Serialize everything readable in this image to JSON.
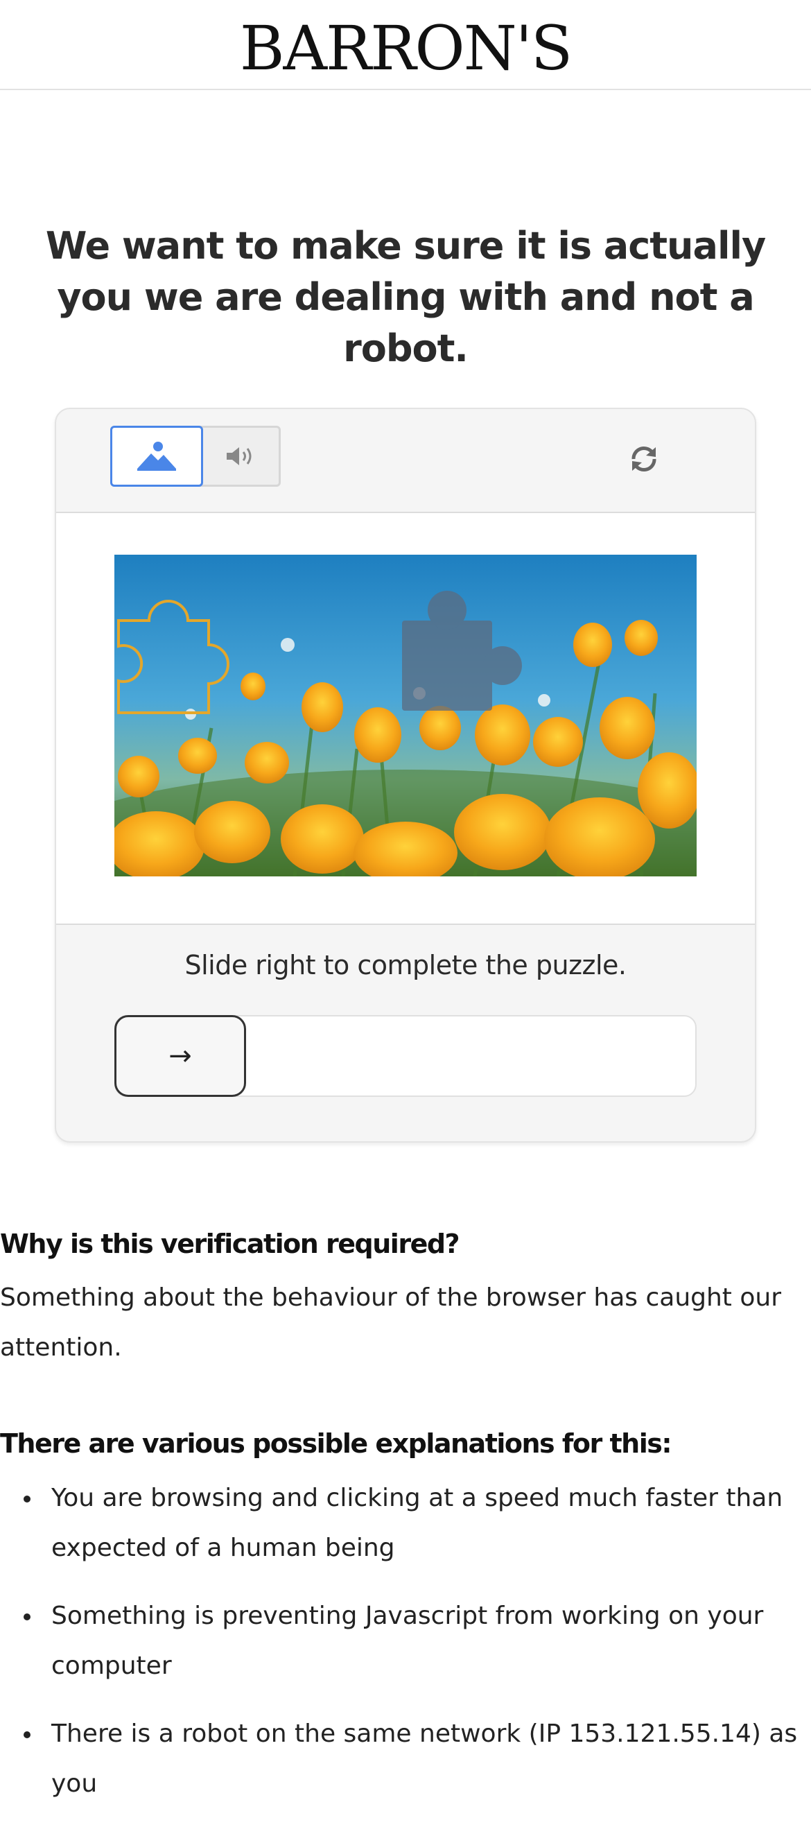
{
  "header": {
    "logo_text": "BARRON'S"
  },
  "headline": "We want to make sure it is actually you we are dealing with and not a robot.",
  "captcha": {
    "modes": [
      {
        "name": "image",
        "icon": "image-icon",
        "active": true
      },
      {
        "name": "audio",
        "icon": "speaker-icon",
        "active": false
      }
    ],
    "refresh_icon": "refresh-icon",
    "instruction": "Slide right to complete the puzzle.",
    "slider_icon": "arrow-right-icon",
    "slider_glyph": "→",
    "accent_color": "#4a86e8"
  },
  "explanation": {
    "why_title": "Why is this verification required?",
    "why_text": "Something about the behaviour of the browser has caught our attention.",
    "reasons_title": "There are various possible explanations for this:",
    "reasons": [
      "You are browsing and clicking at a speed much faster than expected of a human being",
      "Something is preventing Javascript from working on your computer",
      "There is a robot on the same network (IP 153.121.55.14) as you"
    ]
  }
}
